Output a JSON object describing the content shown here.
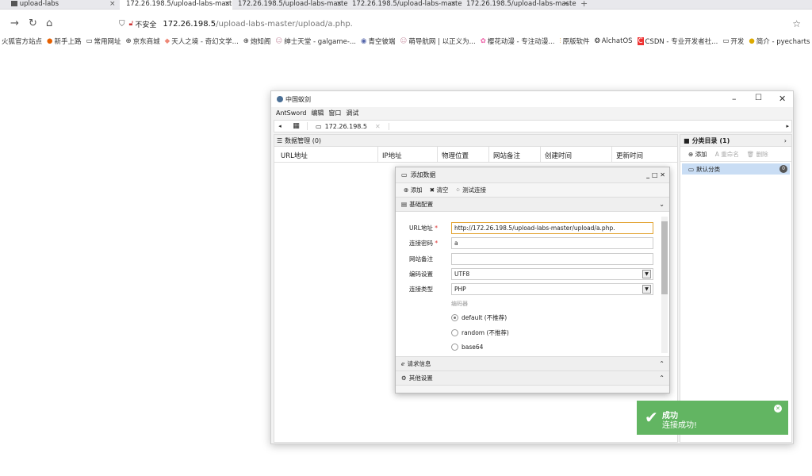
{
  "browser": {
    "tabs": [
      {
        "label": "upload-labs"
      },
      {
        "label": "172.26.198.5/upload-labs-maste"
      },
      {
        "label": "172.26.198.5/upload-labs-maste"
      },
      {
        "label": "172.26.198.5/upload-labs-maste"
      },
      {
        "label": "172.26.198.5/upload-labs-maste"
      }
    ],
    "tab_close": "×",
    "new_tab": "+",
    "insecure": "不安全",
    "url_host": "172.26.198.5",
    "url_path": "/upload-labs-master/upload/a.php.",
    "bookmarks": [
      "火狐官方站点",
      "新手上路",
      "常用网址",
      "京东商城",
      "天人之境 - 奇幻文学...",
      "炮知阁",
      "绅士天堂 - galgame-...",
      "青空彼端",
      "萌导航网 | 以正义为...",
      "樱花动漫 - 专注动漫...",
      "原版软件",
      "AlchatOS",
      "CSDN - 专业开发者社...",
      "开发",
      "简介 - pyecharts"
    ]
  },
  "app": {
    "title": "中国蚁剑",
    "menu": [
      "AntSword",
      "编辑",
      "窗口",
      "调试"
    ],
    "tab_label": "172.26.198.5",
    "list_title": "数据管理 (0)",
    "columns": [
      "URL地址",
      "IP地址",
      "物理位置",
      "网站备注",
      "创建时间",
      "更新时间"
    ],
    "cat_title": "分类目录 (1)",
    "cat_add": "添加",
    "cat_rename": "重命名",
    "cat_delete": "删除",
    "cat_default": "默认分类",
    "cat_count": "0"
  },
  "dialog": {
    "title": "添加数据",
    "btn_add": "添加",
    "btn_clear": "清空",
    "btn_test": "测试连接",
    "sec_basic": "基础配置",
    "lbl_url": "URL地址",
    "lbl_pwd": "连接密码",
    "lbl_note": "网站备注",
    "lbl_enc": "编码设置",
    "lbl_type": "连接类型",
    "req": "*",
    "val_url": "http://172.26.198.5/upload-labs-master/upload/a.php.",
    "val_pwd": "a",
    "val_note": "",
    "val_enc": "UTF8",
    "val_type": "PHP",
    "encoder_label": "编码器",
    "encoders": [
      "default (不推荐)",
      "random (不推荐)",
      "base64"
    ],
    "sec_req": "请求信息",
    "sec_other": "其他设置"
  },
  "toast": {
    "title": "成功",
    "message": "连接成功!"
  }
}
